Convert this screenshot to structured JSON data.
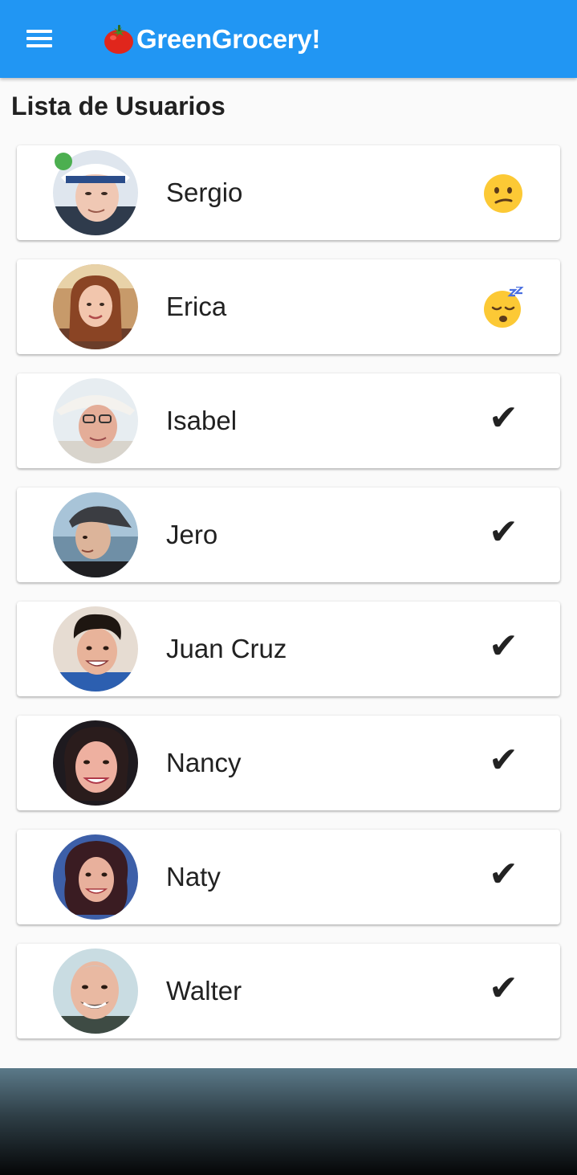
{
  "appbar": {
    "title": "GreenGrocery!",
    "title_icon": "tomato-emoji",
    "menu_icon": "hamburger-menu-icon",
    "color": "#2196f3"
  },
  "page": {
    "heading": "Lista de Usuarios"
  },
  "users": [
    {
      "name": "Sergio",
      "status": "confused-face-emoji",
      "online": true
    },
    {
      "name": "Erica",
      "status": "sleeping-face-emoji",
      "online": false
    },
    {
      "name": "Isabel",
      "status": "check-mark",
      "online": false
    },
    {
      "name": "Jero",
      "status": "check-mark",
      "online": false
    },
    {
      "name": "Juan Cruz",
      "status": "check-mark",
      "online": false
    },
    {
      "name": "Nancy",
      "status": "check-mark",
      "online": false
    },
    {
      "name": "Naty",
      "status": "check-mark",
      "online": false
    },
    {
      "name": "Walter",
      "status": "check-mark",
      "online": false
    }
  ],
  "check_glyph": "✔",
  "colors": {
    "online": "#4caf50",
    "background": "#fafafa"
  }
}
